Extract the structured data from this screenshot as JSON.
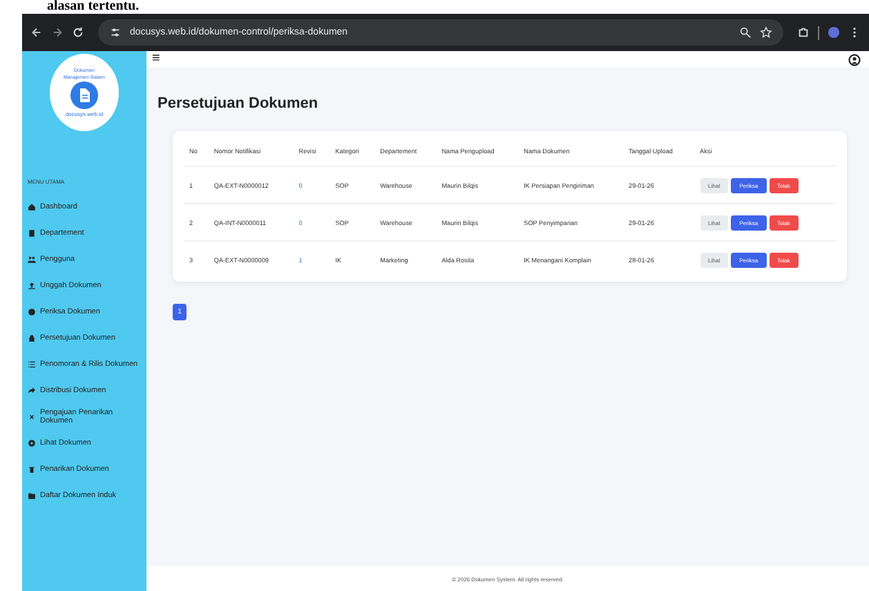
{
  "document_text": "alasan tertentu.",
  "browser": {
    "url": "docusys.web.id/dokumen-control/periksa-dokumen"
  },
  "sidebar": {
    "logo_title": "Dokumen",
    "logo_subtitle": "Manajemen Sistem",
    "logo_domain": "docusys.web.id",
    "section_label": "MENU UTAMA",
    "items": [
      {
        "label": "Dashboard"
      },
      {
        "label": "Departement"
      },
      {
        "label": "Pengguna"
      },
      {
        "label": "Unggah Dokumen"
      },
      {
        "label": "Periksa Dokumen"
      },
      {
        "label": "Persetujuan Dokumen"
      },
      {
        "label": "Penomoran & Rilis Dokumen"
      },
      {
        "label": "Distribusi Dokumen"
      },
      {
        "label": "Pengajuan Penarikan Dokumen"
      },
      {
        "label": "Lihat Dokumen"
      },
      {
        "label": "Penarikan Dokumen"
      },
      {
        "label": "Daftar Dokumen Induk"
      }
    ]
  },
  "header": {
    "menu_glyph": "≡"
  },
  "page_title": "Persetujuan Dokumen",
  "table": {
    "columns": [
      "No",
      "Nomor Notifikasi",
      "Revisi",
      "Kategori",
      "Departement",
      "Nama Pengupload",
      "Nama Dokumen",
      "Tanggal Upload",
      "Aksi"
    ],
    "rows": [
      {
        "cells": [
          "1",
          "QA-EXT-N0000012",
          "0",
          "SOP",
          "Warehouse",
          "Maurin Bilqis",
          "IK Persiapan Pengiriman",
          "29-01-26"
        ],
        "actions": [
          "Lihat",
          "Periksa",
          "Tolak"
        ]
      },
      {
        "cells": [
          "2",
          "QA-INT-N0000011",
          "0",
          "SOP",
          "Warehouse",
          "Maurin Bilqis",
          "SOP Penyimpanan",
          "29-01-26"
        ],
        "actions": [
          "Lihat",
          "Periksa",
          "Tolak"
        ]
      },
      {
        "cells": [
          "3",
          "QA-EXT-N0000009",
          "1",
          "IK",
          "Marketing",
          "Alda Rosita",
          "IK Menangani Komplain",
          "28-01-26"
        ],
        "actions": [
          "Lihat",
          "Periksa",
          "Tolak"
        ]
      }
    ]
  },
  "pagination": [
    {
      "label": "1",
      "selected": true
    }
  ],
  "footer": "© 2026 Dokumen System. All rights reserved."
}
